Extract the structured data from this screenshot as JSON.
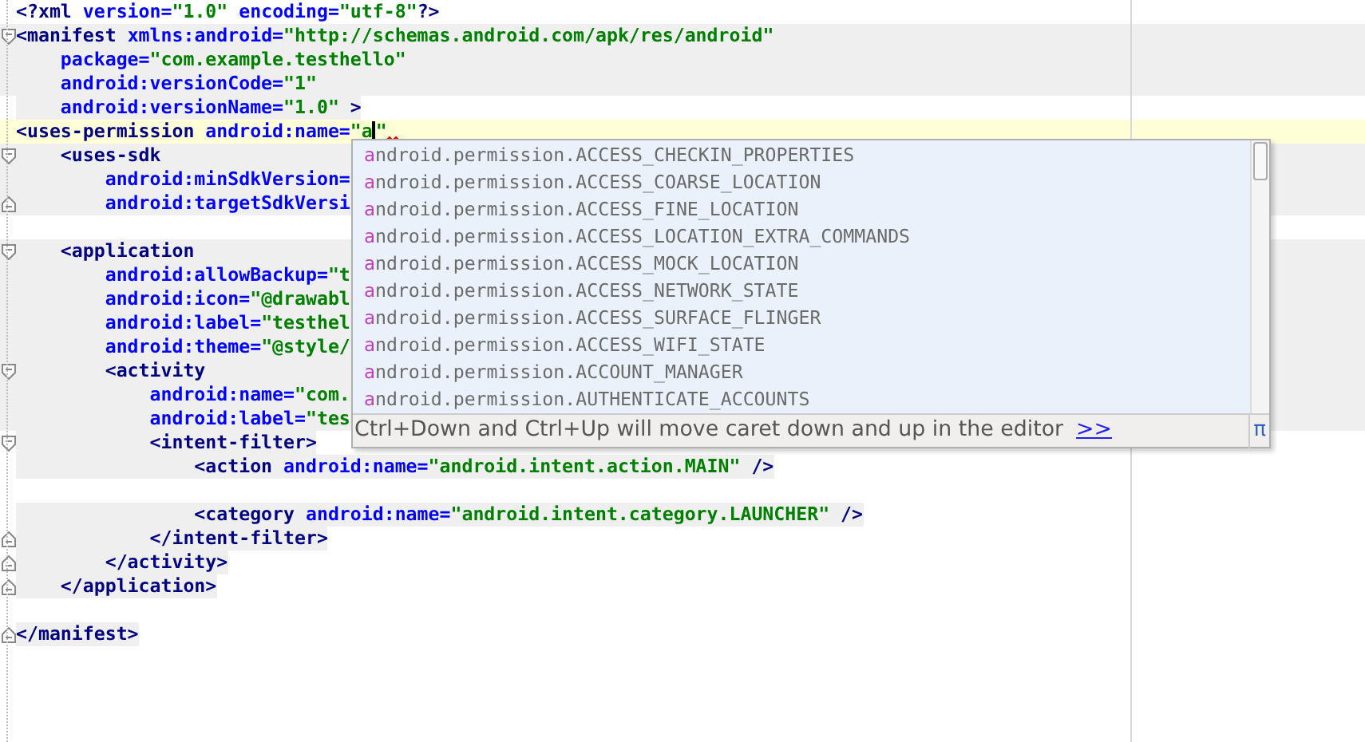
{
  "editor": {
    "lines": [
      {
        "current": false,
        "tokens": [
          {
            "kind": "tag",
            "text": "<?xml "
          },
          {
            "kind": "attr",
            "text": "version="
          },
          {
            "kind": "value",
            "text": "\"1.0\" "
          },
          {
            "kind": "attr",
            "text": "encoding="
          },
          {
            "kind": "value",
            "text": "\"utf-8\""
          },
          {
            "kind": "tag",
            "text": "?>"
          }
        ]
      },
      {
        "shaded": true,
        "current": false,
        "fold_start": true,
        "tokens": [
          {
            "kind": "tag",
            "text": "<manifest "
          },
          {
            "kind": "attr",
            "text": "xmlns:android="
          },
          {
            "kind": "value",
            "text": "\"http://schemas.android.com/apk/res/android\""
          }
        ]
      },
      {
        "shaded": true,
        "current": false,
        "tokens": [
          {
            "kind": "attr",
            "text": "    package="
          },
          {
            "kind": "value",
            "text": "\"com.example.testhello\""
          }
        ]
      },
      {
        "shaded": true,
        "current": false,
        "tokens": [
          {
            "kind": "attr",
            "text": "    android:versionCode="
          },
          {
            "kind": "value",
            "text": "\"1\""
          }
        ]
      },
      {
        "text_shaded": true,
        "current": false,
        "tokens": [
          {
            "kind": "attr",
            "text": "    android:versionName="
          },
          {
            "kind": "value",
            "text": "\"1.0\" "
          },
          {
            "kind": "tag",
            "text": ">"
          }
        ]
      },
      {
        "current": true,
        "tokens": [
          {
            "kind": "tag",
            "text": "<uses-permission "
          },
          {
            "kind": "attr",
            "text": "android:name="
          },
          {
            "kind": "value",
            "text": "\"a"
          },
          {
            "kind": "caret"
          },
          {
            "kind": "value",
            "text": "\""
          }
        ]
      },
      {
        "shaded": true,
        "current": false,
        "fold_start": true,
        "tokens": [
          {
            "kind": "tag",
            "text": "    <uses-sdk"
          }
        ]
      },
      {
        "shaded": true,
        "current": false,
        "tokens": [
          {
            "kind": "attr",
            "text": "        android:minSdkVersion="
          }
        ]
      },
      {
        "shaded": true,
        "current": false,
        "fold_end": true,
        "tokens": [
          {
            "kind": "attr",
            "text": "        android:targetSdkVersi"
          }
        ]
      },
      {
        "current": false
      },
      {
        "shaded": true,
        "current": false,
        "fold_start": true,
        "tokens": [
          {
            "kind": "tag",
            "text": "    <application"
          }
        ]
      },
      {
        "shaded": true,
        "current": false,
        "tokens": [
          {
            "kind": "attr",
            "text": "        android:allowBackup="
          },
          {
            "kind": "value",
            "text": "\"t"
          }
        ]
      },
      {
        "shaded": true,
        "current": false,
        "tokens": [
          {
            "kind": "attr",
            "text": "        android:icon="
          },
          {
            "kind": "value",
            "text": "\"@drawabl"
          }
        ]
      },
      {
        "shaded": true,
        "current": false,
        "tokens": [
          {
            "kind": "attr",
            "text": "        android:label="
          },
          {
            "kind": "value",
            "text": "\"testhel"
          }
        ]
      },
      {
        "shaded": true,
        "current": false,
        "tokens": [
          {
            "kind": "attr",
            "text": "        android:theme="
          },
          {
            "kind": "value",
            "text": "\"@style/"
          }
        ]
      },
      {
        "shaded": true,
        "current": false,
        "fold_start": true,
        "tokens": [
          {
            "kind": "tag",
            "text": "        <activity"
          }
        ]
      },
      {
        "shaded": true,
        "current": false,
        "tokens": [
          {
            "kind": "attr",
            "text": "            android:name="
          },
          {
            "kind": "value",
            "text": "\"com."
          }
        ]
      },
      {
        "shaded": true,
        "current": false,
        "tokens": [
          {
            "kind": "attr",
            "text": "            android:label="
          },
          {
            "kind": "value",
            "text": "\"tes"
          }
        ]
      },
      {
        "text_shaded": true,
        "current": false,
        "fold_start": true,
        "tokens": [
          {
            "kind": "tag",
            "text": "            <intent-filter>"
          }
        ]
      },
      {
        "text_shaded": true,
        "current": false,
        "tokens": [
          {
            "kind": "tag",
            "text": "                <action "
          },
          {
            "kind": "attr",
            "text": "android:name="
          },
          {
            "kind": "value",
            "text": "\"android.intent.action.MAIN\" "
          },
          {
            "kind": "tag",
            "text": "/>"
          }
        ]
      },
      {
        "current": false
      },
      {
        "text_shaded": true,
        "current": false,
        "tokens": [
          {
            "kind": "tag",
            "text": "                <category "
          },
          {
            "kind": "attr",
            "text": "android:name="
          },
          {
            "kind": "value",
            "text": "\"android.intent.category.LAUNCHER\" "
          },
          {
            "kind": "tag",
            "text": "/>"
          }
        ]
      },
      {
        "text_shaded": true,
        "current": false,
        "fold_end": true,
        "tokens": [
          {
            "kind": "tag",
            "text": "            </intent-filter>"
          }
        ]
      },
      {
        "text_shaded": true,
        "current": false,
        "fold_end": true,
        "tokens": [
          {
            "kind": "tag",
            "text": "        </activity>"
          }
        ]
      },
      {
        "text_shaded": true,
        "current": false,
        "fold_end": true,
        "tokens": [
          {
            "kind": "tag",
            "text": "    </application>"
          }
        ]
      },
      {
        "current": false
      },
      {
        "text_shaded": true,
        "current": false,
        "fold_end": true,
        "tokens": [
          {
            "kind": "tag",
            "text": "</manifest>"
          }
        ]
      }
    ]
  },
  "completion": {
    "items": [
      {
        "match": "a",
        "rest": "ndroid.permission.ACCESS_CHECKIN_PROPERTIES"
      },
      {
        "match": "a",
        "rest": "ndroid.permission.ACCESS_COARSE_LOCATION"
      },
      {
        "match": "a",
        "rest": "ndroid.permission.ACCESS_FINE_LOCATION"
      },
      {
        "match": "a",
        "rest": "ndroid.permission.ACCESS_LOCATION_EXTRA_COMMANDS"
      },
      {
        "match": "a",
        "rest": "ndroid.permission.ACCESS_MOCK_LOCATION"
      },
      {
        "match": "a",
        "rest": "ndroid.permission.ACCESS_NETWORK_STATE"
      },
      {
        "match": "a",
        "rest": "ndroid.permission.ACCESS_SURFACE_FLINGER"
      },
      {
        "match": "a",
        "rest": "ndroid.permission.ACCESS_WIFI_STATE"
      },
      {
        "match": "a",
        "rest": "ndroid.permission.ACCOUNT_MANAGER"
      },
      {
        "match": "a",
        "rest": "ndroid.permission.AUTHENTICATE_ACCOUNTS"
      }
    ],
    "hint": "Ctrl+Down and Ctrl+Up will move caret down and up in the editor",
    "hint_link": ">>",
    "pi": "π"
  }
}
